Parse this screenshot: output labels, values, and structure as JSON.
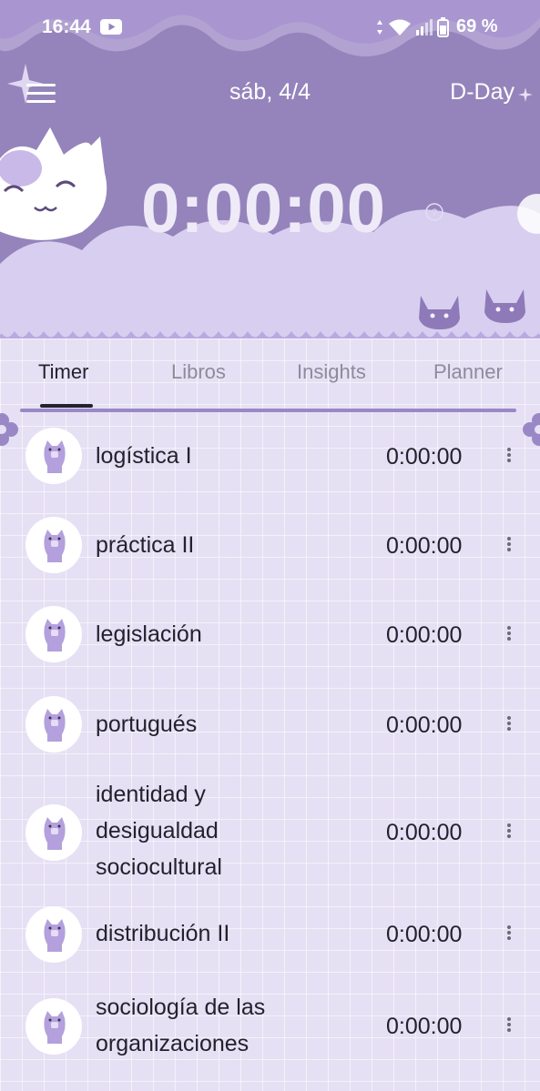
{
  "status_bar": {
    "time": "16:44",
    "battery": "69 %",
    "icons": [
      "youtube-icon",
      "vibrate-icon",
      "wifi-icon",
      "signal-icon",
      "battery-icon"
    ]
  },
  "header": {
    "date": "sáb, 4/4",
    "dday_label": "D-Day",
    "timer": "0:00:00"
  },
  "tabs": [
    {
      "label": "Timer",
      "active": true
    },
    {
      "label": "Libros",
      "active": false
    },
    {
      "label": "Insights",
      "active": false
    },
    {
      "label": "Planner",
      "active": false
    }
  ],
  "subjects": [
    {
      "name": "logística I",
      "time": "0:00:00"
    },
    {
      "name": "práctica II",
      "time": "0:00:00"
    },
    {
      "name": "legislación",
      "time": "0:00:00"
    },
    {
      "name": "portugués",
      "time": "0:00:00"
    },
    {
      "name": "identidad y\ndesigualdad\nsociocultural",
      "time": "0:00:00"
    },
    {
      "name": "distribución II",
      "time": "0:00:00"
    },
    {
      "name": "sociología de las\norganizaciones",
      "time": "0:00:00"
    }
  ],
  "colors": {
    "header_bg": "#9584bb",
    "cloud": "#d8cff0",
    "accent": "#9a88c6",
    "text": "#24212e"
  }
}
